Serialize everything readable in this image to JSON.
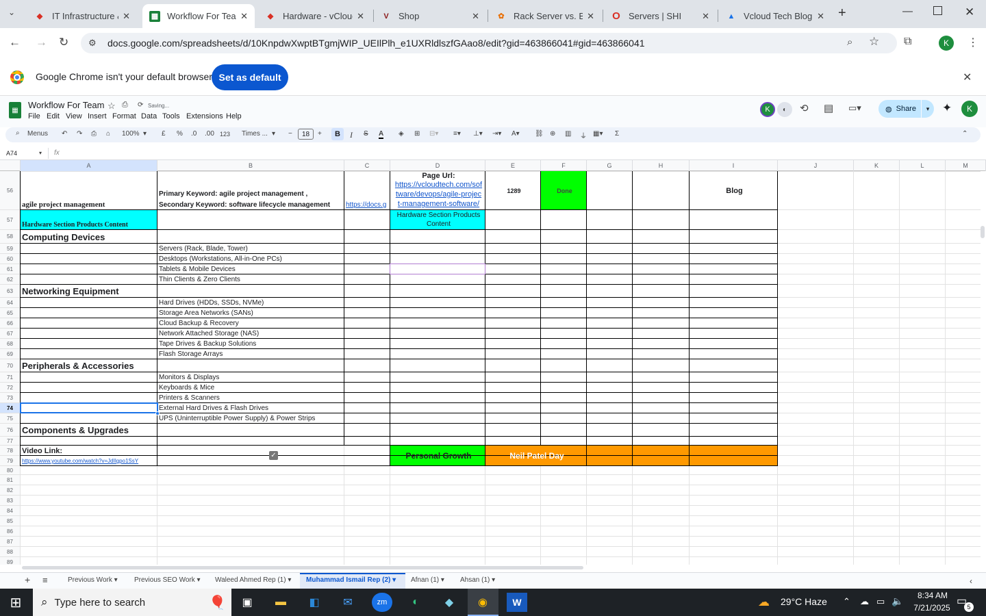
{
  "browser": {
    "tabs": [
      {
        "title": "IT Infrastructure &",
        "favicon": "sheets-icon",
        "color": "#d93025"
      },
      {
        "title": "Workflow For Team",
        "favicon": "sheets-icon",
        "color": "#188038"
      },
      {
        "title": "Hardware - vCloud",
        "favicon": "vcloud-icon",
        "color": "#d93025"
      },
      {
        "title": "Shop",
        "favicon": "v-icon",
        "color": "#8b1a1a"
      },
      {
        "title": "Rack Server vs. Bla",
        "favicon": "gear-icon",
        "color": "#e8710a"
      },
      {
        "title": "Servers | SHI",
        "favicon": "opera-icon",
        "color": "#d93025"
      },
      {
        "title": "Vcloud Tech Blog",
        "favicon": "drive-icon",
        "color": "#1a73e8"
      }
    ],
    "url": "docs.google.com/spreadsheets/d/10KnpdwXwptBTgmjWIP_UEIlPlh_e1UXRldlszfGAao8/edit?gid=463866041#gid=463866041",
    "profile": "K",
    "infobar": {
      "message": "Google Chrome isn't your default browser",
      "button": "Set as default"
    }
  },
  "sheet": {
    "title": "Workflow For Team",
    "status": "Saving...",
    "menus": [
      "File",
      "Edit",
      "View",
      "Insert",
      "Format",
      "Data",
      "Tools",
      "Extensions",
      "Help"
    ],
    "share": "Share",
    "toolbar": {
      "search": "Menus",
      "zoom": "100%",
      "currency": "£",
      "percent": "%",
      "dec_less": ".0",
      "dec_more": ".00",
      "number": "123",
      "font": "Times ...",
      "size": "18",
      "bold": "B",
      "italic": "I",
      "sum": "Σ"
    },
    "namebox": "A74",
    "fx": "fx",
    "columns": [
      "A",
      "B",
      "C",
      "D",
      "E",
      "F",
      "G",
      "H",
      "I",
      "J",
      "K",
      "L",
      "M"
    ],
    "cells": {
      "a56": "agile project management",
      "b56a": "Primary Keyword:  agile project management ,",
      "b56b": "Secondary Keyword:  software lifecycle management",
      "c56": "https://docs.g",
      "d56a": "Page Url:",
      "d56b": "https://vcloudtech.com/sof",
      "d56c": "tware/devops/agile-projec",
      "d56d": "t-management-software/",
      "e56": "1289",
      "f56": "Done",
      "i56": "Blog",
      "a57": "Hardware Section Products Content",
      "d57a": "Hardware Section Products",
      "d57b": "Content",
      "a58": "Computing Devices",
      "b59": "Servers (Rack, Blade, Tower)",
      "b60": "Desktops (Workstations, All-in-One PCs)",
      "b61": "Tablets & Mobile Devices",
      "b62": "Thin Clients & Zero Clients",
      "a63": "Networking Equipment",
      "b64": "Hard Drives (HDDs, SSDs, NVMe)",
      "b65": "Storage Area Networks (SANs)",
      "b66": "Cloud Backup & Recovery",
      "b67": "Network Attached Storage (NAS)",
      "b68": "Tape Drives & Backup Solutions",
      "b69": "Flash Storage Arrays",
      "a70": "Peripherals & Accessories",
      "b71": "Monitors & Displays",
      "b72": "Keyboards & Mice",
      "b73": "Printers & Scanners",
      "b74": "External Hard Drives & Flash Drives",
      "b75": "UPS (Uninterruptible Power Supply) & Power Strips",
      "a76": "Components & Upgrades",
      "a78": "Video Link:",
      "a79": "https://www.youtube.com/watch?v=JdIlgpo1SsY",
      "d78": "Personal Growth",
      "e78": "Neil Patel Day"
    },
    "rows": [
      "56",
      "57",
      "58",
      "59",
      "60",
      "61",
      "62",
      "63",
      "64",
      "65",
      "66",
      "67",
      "68",
      "69",
      "70",
      "71",
      "72",
      "73",
      "74",
      "75",
      "76",
      "77",
      "78",
      "79",
      "80",
      "81",
      "82",
      "83",
      "84",
      "85",
      "86",
      "87",
      "88",
      "89"
    ],
    "tabs": [
      "Previous Work",
      "Previous SEO Work",
      "Waleed Ahmed Rep (1)",
      "Muhammad Ismail Rep (2)",
      "Afnan (1)",
      "Ahsan (1)"
    ],
    "active_tab": "Muhammad Ismail Rep (2)"
  },
  "taskbar": {
    "search": "Type here to search",
    "weather": "29°C  Haze",
    "time": "8:34 AM",
    "date": "7/21/2025",
    "notifications": "5"
  },
  "colors": {
    "green": "#00ff00",
    "cyan": "#00ffff",
    "orange": "#ff9900",
    "accent": "#0b57d0"
  }
}
